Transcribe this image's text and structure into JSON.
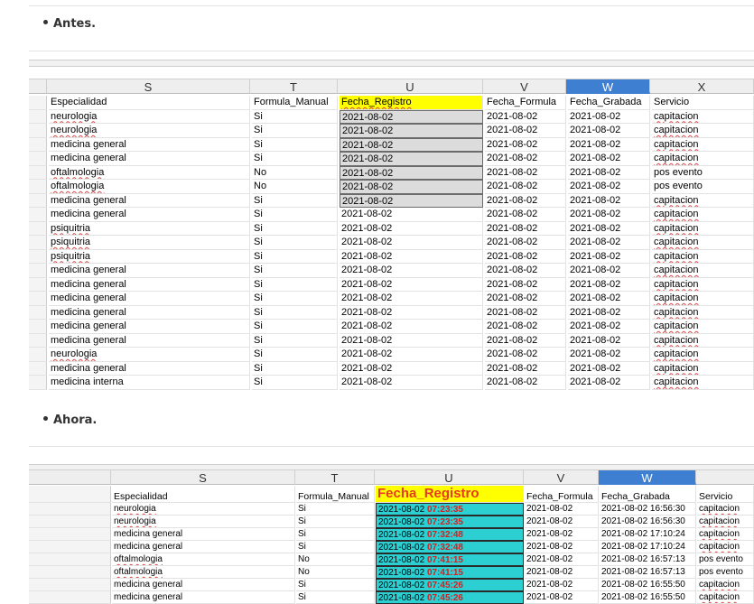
{
  "sections": {
    "before_label": "Antes.",
    "after_label": "Ahora."
  },
  "before": {
    "columns": [
      "S",
      "T",
      "U",
      "V",
      "W",
      "X"
    ],
    "selected_column": "W",
    "headers": [
      "Especialidad",
      "Formula_Manual",
      "Fecha_Registro",
      "Fecha_Formula",
      "Fecha_Grabada",
      "Servicio"
    ],
    "rows": [
      [
        "neurologia",
        "Si",
        "2021-08-02",
        "2021-08-02",
        "2021-08-02",
        "capitacion"
      ],
      [
        "neurologia",
        "Si",
        "2021-08-02",
        "2021-08-02",
        "2021-08-02",
        "capitacion"
      ],
      [
        "medicina general",
        "Si",
        "2021-08-02",
        "2021-08-02",
        "2021-08-02",
        "capitacion"
      ],
      [
        "medicina general",
        "Si",
        "2021-08-02",
        "2021-08-02",
        "2021-08-02",
        "capitacion"
      ],
      [
        "oftalmologia",
        "No",
        "2021-08-02",
        "2021-08-02",
        "2021-08-02",
        "pos evento"
      ],
      [
        "oftalmologia",
        "No",
        "2021-08-02",
        "2021-08-02",
        "2021-08-02",
        "pos evento"
      ],
      [
        "medicina general",
        "Si",
        "2021-08-02",
        "2021-08-02",
        "2021-08-02",
        "capitacion"
      ],
      [
        "medicina general",
        "Si",
        "2021-08-02",
        "2021-08-02",
        "2021-08-02",
        "capitacion"
      ],
      [
        "psiquitria",
        "Si",
        "2021-08-02",
        "2021-08-02",
        "2021-08-02",
        "capitacion"
      ],
      [
        "psiquitria",
        "Si",
        "2021-08-02",
        "2021-08-02",
        "2021-08-02",
        "capitacion"
      ],
      [
        "psiquitria",
        "Si",
        "2021-08-02",
        "2021-08-02",
        "2021-08-02",
        "capitacion"
      ],
      [
        "medicina general",
        "Si",
        "2021-08-02",
        "2021-08-02",
        "2021-08-02",
        "capitacion"
      ],
      [
        "medicina general",
        "Si",
        "2021-08-02",
        "2021-08-02",
        "2021-08-02",
        "capitacion"
      ],
      [
        "medicina general",
        "Si",
        "2021-08-02",
        "2021-08-02",
        "2021-08-02",
        "capitacion"
      ],
      [
        "medicina general",
        "Si",
        "2021-08-02",
        "2021-08-02",
        "2021-08-02",
        "capitacion"
      ],
      [
        "medicina general",
        "Si",
        "2021-08-02",
        "2021-08-02",
        "2021-08-02",
        "capitacion"
      ],
      [
        "medicina general",
        "Si",
        "2021-08-02",
        "2021-08-02",
        "2021-08-02",
        "capitacion"
      ],
      [
        "neurologia",
        "Si",
        "2021-08-02",
        "2021-08-02",
        "2021-08-02",
        "capitacion"
      ],
      [
        "medicina general",
        "Si",
        "2021-08-02",
        "2021-08-02",
        "2021-08-02",
        "capitacion"
      ],
      [
        "medicina interna",
        "Si",
        "2021-08-02",
        "2021-08-02",
        "2021-08-02",
        "capitacion"
      ]
    ]
  },
  "after": {
    "columns": [
      "S",
      "T",
      "U",
      "V",
      "W"
    ],
    "selected_column": "W",
    "headers": [
      "Especialidad",
      "Formula_Manual",
      "Fecha_Registro",
      "Fecha_Formula",
      "Fecha_Grabada",
      "Servicio"
    ],
    "rows": [
      [
        "neurologia",
        "Si",
        "2021-08-02",
        "07:23:35",
        "2021-08-02",
        "2021-08-02 16:56:30",
        "capitacion"
      ],
      [
        "neurologia",
        "Si",
        "2021-08-02",
        "07:23:35",
        "2021-08-02",
        "2021-08-02 16:56:30",
        "capitacion"
      ],
      [
        "medicina general",
        "Si",
        "2021-08-02",
        "07:32:48",
        "2021-08-02",
        "2021-08-02 17:10:24",
        "capitacion"
      ],
      [
        "medicina general",
        "Si",
        "2021-08-02",
        "07:32:48",
        "2021-08-02",
        "2021-08-02 17:10:24",
        "capitacion"
      ],
      [
        "oftalmologia",
        "No",
        "2021-08-02",
        "07:41:15",
        "2021-08-02",
        "2021-08-02 16:57:13",
        "pos evento"
      ],
      [
        "oftalmologia",
        "No",
        "2021-08-02",
        "07:41:15",
        "2021-08-02",
        "2021-08-02 16:57:13",
        "pos evento"
      ],
      [
        "medicina general",
        "Si",
        "2021-08-02",
        "07:45:26",
        "2021-08-02",
        "2021-08-02 16:55:50",
        "capitacion"
      ],
      [
        "medicina general",
        "Si",
        "2021-08-02",
        "07:45:26",
        "2021-08-02",
        "2021-08-02 16:55:50",
        "capitacion"
      ]
    ]
  },
  "colors": {
    "selected_header": "#3e7fd2",
    "yellow_header": "#ffff00",
    "cyan_cells": "#2ccfd2",
    "red_time": "#d81f1f"
  }
}
